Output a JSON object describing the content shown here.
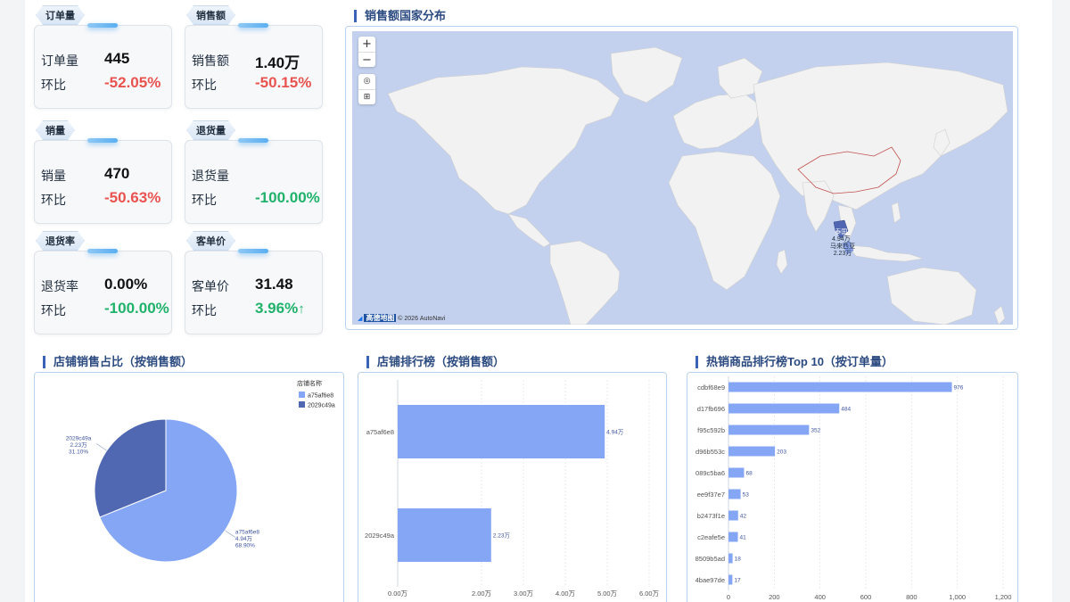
{
  "kpis": [
    {
      "tag": "订单量",
      "label": "订单量",
      "value": "445",
      "change_label": "环比",
      "change": "-52.05%",
      "trend": "down"
    },
    {
      "tag": "销售额",
      "label": "销售额",
      "value": "1.40万",
      "change_label": "环比",
      "change": "-50.15%",
      "trend": "down"
    },
    {
      "tag": "销量",
      "label": "销量",
      "value": "470",
      "change_label": "环比",
      "change": "-50.63%",
      "trend": "down"
    },
    {
      "tag": "退货量",
      "label": "退货量",
      "value": "",
      "change_label": "环比",
      "change": "-100.00%",
      "trend": "down-green"
    },
    {
      "tag": "退货率",
      "label": "退货率",
      "value": "0.00%",
      "change_label": "环比",
      "change": "-100.00%",
      "trend": "down-green"
    },
    {
      "tag": "客单价",
      "label": "客单价",
      "value": "31.48",
      "change_label": "环比",
      "change": "3.96%",
      "trend": "up",
      "trend_icon": "arrow-up-icon"
    }
  ],
  "map": {
    "title": "销售额国家分布",
    "zoom_in": "+",
    "zoom_out": "−",
    "credit_logo": "高德地图",
    "credit": "© 2026 AutoNavi",
    "labels": [
      {
        "name": "泰国",
        "value": "4.94万"
      },
      {
        "name": "马来西亚",
        "value": "2.23万"
      }
    ]
  },
  "pie": {
    "title": "店铺销售占比（按销售额）",
    "legend_title": "店铺名称",
    "colors": [
      "#85a6f5",
      "#5068b2"
    ],
    "chart_data": {
      "type": "pie",
      "slices": [
        {
          "name": "a75af6e8",
          "value": 4.94,
          "value_label": "4.94万",
          "percent": "68.90%"
        },
        {
          "name": "2029c49a",
          "value": 2.23,
          "value_label": "2.23万",
          "percent": "31.10%"
        }
      ]
    }
  },
  "store_rank": {
    "title": "店铺排行榜（按销售额）",
    "chart_data": {
      "type": "bar",
      "orientation": "horizontal",
      "categories": [
        "a75af6e8",
        "2029c49a"
      ],
      "values": [
        4.94,
        2.23
      ],
      "value_labels": [
        "4.94万",
        "2.23万"
      ],
      "xlim": [
        0,
        6
      ],
      "x_ticks": [
        "0.00万",
        "2.00万",
        "3.00万",
        "4.00万",
        "5.00万",
        "6.00万"
      ],
      "x_tick_values": [
        0,
        2,
        3,
        4,
        5,
        6
      ],
      "color": "#85a6f5"
    }
  },
  "product_rank": {
    "title": "热销商品排行榜Top 10（按订单量）",
    "chart_data": {
      "type": "bar",
      "orientation": "horizontal",
      "categories": [
        "cdbf68e9",
        "d17fb696",
        "f95c592b",
        "d96b553c",
        "089c5ba6",
        "ee9f37e7",
        "b2473f1e",
        "c2eafe5e",
        "8509b5ad",
        "4bae97de"
      ],
      "values": [
        976,
        484,
        352,
        203,
        68,
        53,
        42,
        41,
        18,
        17
      ],
      "xlim": [
        0,
        1200
      ],
      "x_ticks": [
        "0",
        "200",
        "400",
        "600",
        "800",
        "1,000",
        "1,200"
      ],
      "x_tick_values": [
        0,
        200,
        400,
        600,
        800,
        1000,
        1200
      ],
      "color": "#85a6f5"
    }
  }
}
